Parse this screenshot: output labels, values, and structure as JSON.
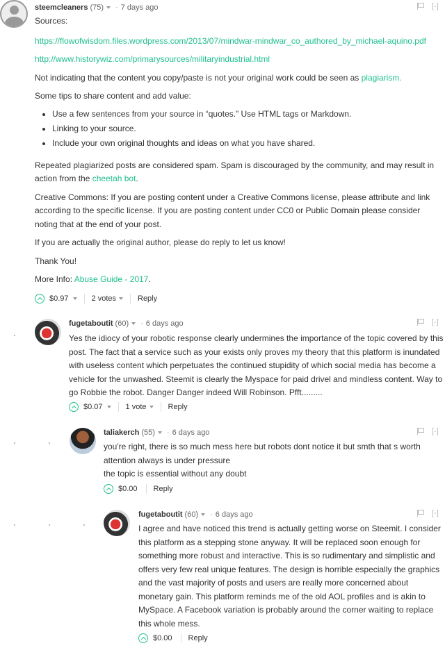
{
  "comments": {
    "c1": {
      "author": "steemcleaners",
      "reputation": "(75)",
      "time": "7 days ago",
      "tools": "[-]",
      "sources_label": "Sources:",
      "link1": "https://flowofwisdom.files.wordpress.com/2013/07/mindwar-mindwar_co_authored_by_michael-aquino.pdf",
      "link2": "http://www.historywiz.com/primarysources/militaryindustrial.html",
      "p1_text": "Not indicating that the content you copy/paste is not your original work could be seen as ",
      "p1_link": "plagiarism.",
      "p2": "Some tips to share content and add value:",
      "bullets": [
        "Use a few sentences from your source in “quotes.” Use HTML tags or Markdown.",
        "Linking to your source.",
        "Include your own original thoughts and ideas on what you have shared."
      ],
      "p3_text": "Repeated plagiarized posts are considered spam. Spam is discouraged by the community, and may result in action from the ",
      "p3_link": "cheetah bot",
      "p3_end": ".",
      "p4": "Creative Commons: If you are posting content under a Creative Commons license, please attribute and link according to the specific license. If you are posting content under CC0 or Public Domain please consider noting that at the end of your post.",
      "p5": "If you are actually the original author, please do reply to let us know!",
      "p6": "Thank You!",
      "p7_text": "More Info: ",
      "p7_link": "Abuse Guide - 2017",
      "p7_end": ".",
      "payout": "$0.97",
      "votes": "2 votes",
      "reply": "Reply"
    },
    "c2": {
      "author": "fugetaboutit",
      "reputation": "(60)",
      "time": "6 days ago",
      "tools": "[-]",
      "text": "Yes the idiocy of your robotic response clearly undermines the importance of the topic covered by this post. The fact that a service such as your exists only proves my theory that this platform is inundated with useless content which perpetuates the continued stupidity of which social media has become a vehicle for the unwashed. Steemit is clearly the Myspace for paid drivel and mindless content. Way to go Robbie the robot. Danger Danger indeed Will Robinson. Pfft.........",
      "payout": "$0.07",
      "votes": "1 vote",
      "reply": "Reply"
    },
    "c3": {
      "author": "taliakerch",
      "reputation": "(55)",
      "time": "6 days ago",
      "tools": "[-]",
      "line1": "you're right, there is so much mess here but robots dont notice it but smth that s worth attention always is under pressure",
      "line2": "the topic is essential without any doubt",
      "payout": "$0.00",
      "reply": "Reply"
    },
    "c4": {
      "author": "fugetaboutit",
      "reputation": "(60)",
      "time": "6 days ago",
      "tools": "[-]",
      "text": "I agree and have noticed this trend is actually getting worse on Steemit. I consider this platform as a stepping stone anyway. It will be replaced soon enough for something more robust and interactive. This is so rudimentary and simplistic and offers very few real unique features. The design is horrible especially the graphics and the vast majority of posts and users are really more concerned about monetary gain. This platform reminds me of the old AOL profiles and is akin to MySpace. A Facebook variation is probably around the corner waiting to replace this whole mess.",
      "payout": "$0.00",
      "reply": "Reply"
    }
  },
  "colors": {
    "link": "#1fbf8f",
    "text": "#333333",
    "muted": "#999999"
  },
  "icons": [
    "upvote-icon",
    "flag-icon",
    "dropdown-caret-icon",
    "avatar-placeholder-icon"
  ]
}
